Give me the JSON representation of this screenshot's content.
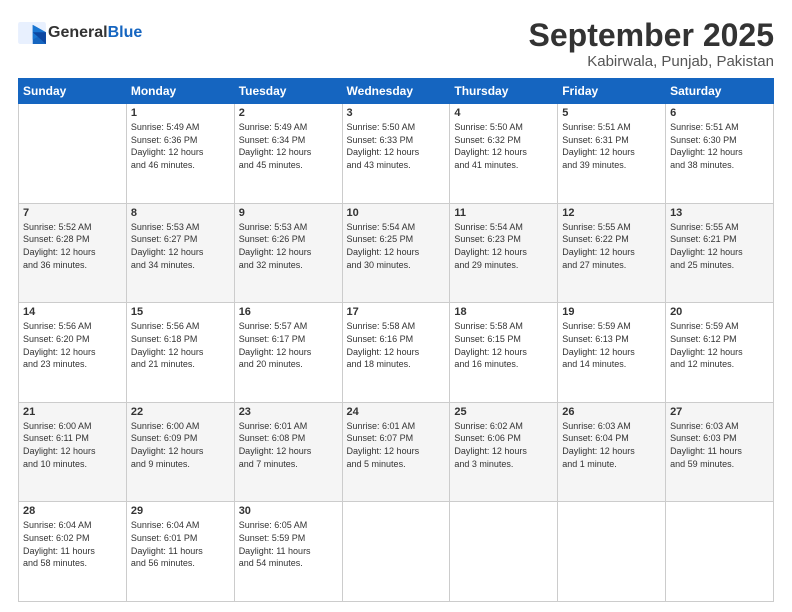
{
  "header": {
    "logo_line1": "General",
    "logo_line2": "Blue",
    "month_title": "September 2025",
    "subtitle": "Kabirwala, Punjab, Pakistan"
  },
  "weekdays": [
    "Sunday",
    "Monday",
    "Tuesday",
    "Wednesday",
    "Thursday",
    "Friday",
    "Saturday"
  ],
  "weeks": [
    [
      {
        "day": "",
        "info": ""
      },
      {
        "day": "1",
        "info": "Sunrise: 5:49 AM\nSunset: 6:36 PM\nDaylight: 12 hours\nand 46 minutes."
      },
      {
        "day": "2",
        "info": "Sunrise: 5:49 AM\nSunset: 6:34 PM\nDaylight: 12 hours\nand 45 minutes."
      },
      {
        "day": "3",
        "info": "Sunrise: 5:50 AM\nSunset: 6:33 PM\nDaylight: 12 hours\nand 43 minutes."
      },
      {
        "day": "4",
        "info": "Sunrise: 5:50 AM\nSunset: 6:32 PM\nDaylight: 12 hours\nand 41 minutes."
      },
      {
        "day": "5",
        "info": "Sunrise: 5:51 AM\nSunset: 6:31 PM\nDaylight: 12 hours\nand 39 minutes."
      },
      {
        "day": "6",
        "info": "Sunrise: 5:51 AM\nSunset: 6:30 PM\nDaylight: 12 hours\nand 38 minutes."
      }
    ],
    [
      {
        "day": "7",
        "info": "Sunrise: 5:52 AM\nSunset: 6:28 PM\nDaylight: 12 hours\nand 36 minutes."
      },
      {
        "day": "8",
        "info": "Sunrise: 5:53 AM\nSunset: 6:27 PM\nDaylight: 12 hours\nand 34 minutes."
      },
      {
        "day": "9",
        "info": "Sunrise: 5:53 AM\nSunset: 6:26 PM\nDaylight: 12 hours\nand 32 minutes."
      },
      {
        "day": "10",
        "info": "Sunrise: 5:54 AM\nSunset: 6:25 PM\nDaylight: 12 hours\nand 30 minutes."
      },
      {
        "day": "11",
        "info": "Sunrise: 5:54 AM\nSunset: 6:23 PM\nDaylight: 12 hours\nand 29 minutes."
      },
      {
        "day": "12",
        "info": "Sunrise: 5:55 AM\nSunset: 6:22 PM\nDaylight: 12 hours\nand 27 minutes."
      },
      {
        "day": "13",
        "info": "Sunrise: 5:55 AM\nSunset: 6:21 PM\nDaylight: 12 hours\nand 25 minutes."
      }
    ],
    [
      {
        "day": "14",
        "info": "Sunrise: 5:56 AM\nSunset: 6:20 PM\nDaylight: 12 hours\nand 23 minutes."
      },
      {
        "day": "15",
        "info": "Sunrise: 5:56 AM\nSunset: 6:18 PM\nDaylight: 12 hours\nand 21 minutes."
      },
      {
        "day": "16",
        "info": "Sunrise: 5:57 AM\nSunset: 6:17 PM\nDaylight: 12 hours\nand 20 minutes."
      },
      {
        "day": "17",
        "info": "Sunrise: 5:58 AM\nSunset: 6:16 PM\nDaylight: 12 hours\nand 18 minutes."
      },
      {
        "day": "18",
        "info": "Sunrise: 5:58 AM\nSunset: 6:15 PM\nDaylight: 12 hours\nand 16 minutes."
      },
      {
        "day": "19",
        "info": "Sunrise: 5:59 AM\nSunset: 6:13 PM\nDaylight: 12 hours\nand 14 minutes."
      },
      {
        "day": "20",
        "info": "Sunrise: 5:59 AM\nSunset: 6:12 PM\nDaylight: 12 hours\nand 12 minutes."
      }
    ],
    [
      {
        "day": "21",
        "info": "Sunrise: 6:00 AM\nSunset: 6:11 PM\nDaylight: 12 hours\nand 10 minutes."
      },
      {
        "day": "22",
        "info": "Sunrise: 6:00 AM\nSunset: 6:09 PM\nDaylight: 12 hours\nand 9 minutes."
      },
      {
        "day": "23",
        "info": "Sunrise: 6:01 AM\nSunset: 6:08 PM\nDaylight: 12 hours\nand 7 minutes."
      },
      {
        "day": "24",
        "info": "Sunrise: 6:01 AM\nSunset: 6:07 PM\nDaylight: 12 hours\nand 5 minutes."
      },
      {
        "day": "25",
        "info": "Sunrise: 6:02 AM\nSunset: 6:06 PM\nDaylight: 12 hours\nand 3 minutes."
      },
      {
        "day": "26",
        "info": "Sunrise: 6:03 AM\nSunset: 6:04 PM\nDaylight: 12 hours\nand 1 minute."
      },
      {
        "day": "27",
        "info": "Sunrise: 6:03 AM\nSunset: 6:03 PM\nDaylight: 11 hours\nand 59 minutes."
      }
    ],
    [
      {
        "day": "28",
        "info": "Sunrise: 6:04 AM\nSunset: 6:02 PM\nDaylight: 11 hours\nand 58 minutes."
      },
      {
        "day": "29",
        "info": "Sunrise: 6:04 AM\nSunset: 6:01 PM\nDaylight: 11 hours\nand 56 minutes."
      },
      {
        "day": "30",
        "info": "Sunrise: 6:05 AM\nSunset: 5:59 PM\nDaylight: 11 hours\nand 54 minutes."
      },
      {
        "day": "",
        "info": ""
      },
      {
        "day": "",
        "info": ""
      },
      {
        "day": "",
        "info": ""
      },
      {
        "day": "",
        "info": ""
      }
    ]
  ]
}
